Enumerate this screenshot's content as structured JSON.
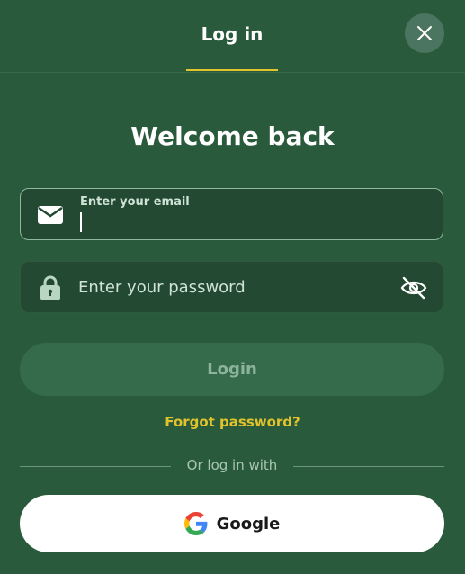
{
  "header": {
    "tab_label": "Log in"
  },
  "title": "Welcome back",
  "email": {
    "label": "Enter your email",
    "value": ""
  },
  "password": {
    "placeholder": "Enter your password",
    "value": ""
  },
  "login_button": "Login",
  "forgot_password": "Forgot password?",
  "divider_text": "Or log in with",
  "google_button": "Google",
  "icons": {
    "close": "close-icon",
    "mail": "mail-icon",
    "lock": "lock-icon",
    "eye_off": "eye-off-icon",
    "google": "google-logo-icon"
  },
  "colors": {
    "background": "#2a5a3c",
    "accent": "#e1c32c",
    "field_bg": "#244932",
    "login_button_bg": "#356b4b",
    "google_button_bg": "#ffffff"
  }
}
